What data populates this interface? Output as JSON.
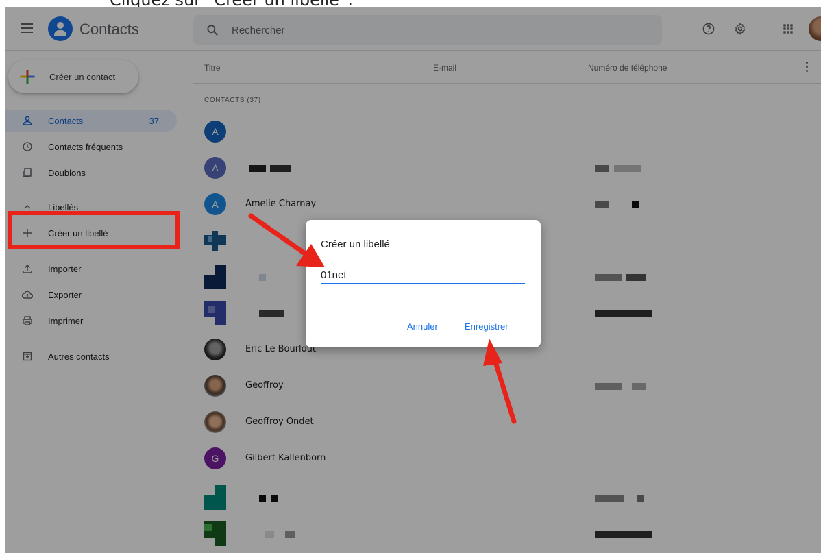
{
  "caption": "Cliquez sur “Créer un libellé”.",
  "header": {
    "app_title": "Contacts",
    "search_placeholder": "Rechercher",
    "icons": [
      "menu-icon",
      "contacts-logo-icon",
      "search-icon",
      "help-icon",
      "settings-icon",
      "apps-grid-icon",
      "account-avatar"
    ]
  },
  "sidebar": {
    "create_contact": "Créer un contact",
    "items": [
      {
        "label": "Contacts",
        "count": "37",
        "icon": "person-icon"
      },
      {
        "label": "Contacts fréquents",
        "icon": "history-icon"
      },
      {
        "label": "Doublons",
        "icon": "copy-icon"
      },
      {
        "label": "Libellés",
        "icon": "chevron-up-icon"
      },
      {
        "label": "Créer un libellé",
        "icon": "plus-icon"
      },
      {
        "label": "Importer",
        "icon": "upload-icon"
      },
      {
        "label": "Exporter",
        "icon": "cloud-upload-icon"
      },
      {
        "label": "Imprimer",
        "icon": "print-icon"
      },
      {
        "label": "Autres contacts",
        "icon": "archive-icon"
      }
    ]
  },
  "table": {
    "columns": [
      "Titre",
      "E-mail",
      "Numéro de téléphone"
    ],
    "section_title": "CONTACTS (37)",
    "rows": [
      {
        "letter": "A",
        "name": ""
      },
      {
        "letter": "A",
        "name": ""
      },
      {
        "letter": "A",
        "name": "Amelie Charnay"
      },
      {
        "letter": "",
        "name": ""
      },
      {
        "letter": "",
        "name": ""
      },
      {
        "letter": "",
        "name": ""
      },
      {
        "letter": "",
        "name": "Eric Le Bourlout"
      },
      {
        "letter": "",
        "name": "Geoffroy"
      },
      {
        "letter": "",
        "name": "Geoffroy Ondet"
      },
      {
        "letter": "G",
        "name": "Gilbert Kallenborn"
      },
      {
        "letter": "",
        "name": ""
      },
      {
        "letter": "",
        "name": ""
      }
    ]
  },
  "dialog": {
    "title": "Créer un libellé",
    "input_value": "01net",
    "cancel_label": "Annuler",
    "save_label": "Enregistrer"
  },
  "colors": {
    "accent": "#1a73e8",
    "highlight": "#e8231a"
  }
}
